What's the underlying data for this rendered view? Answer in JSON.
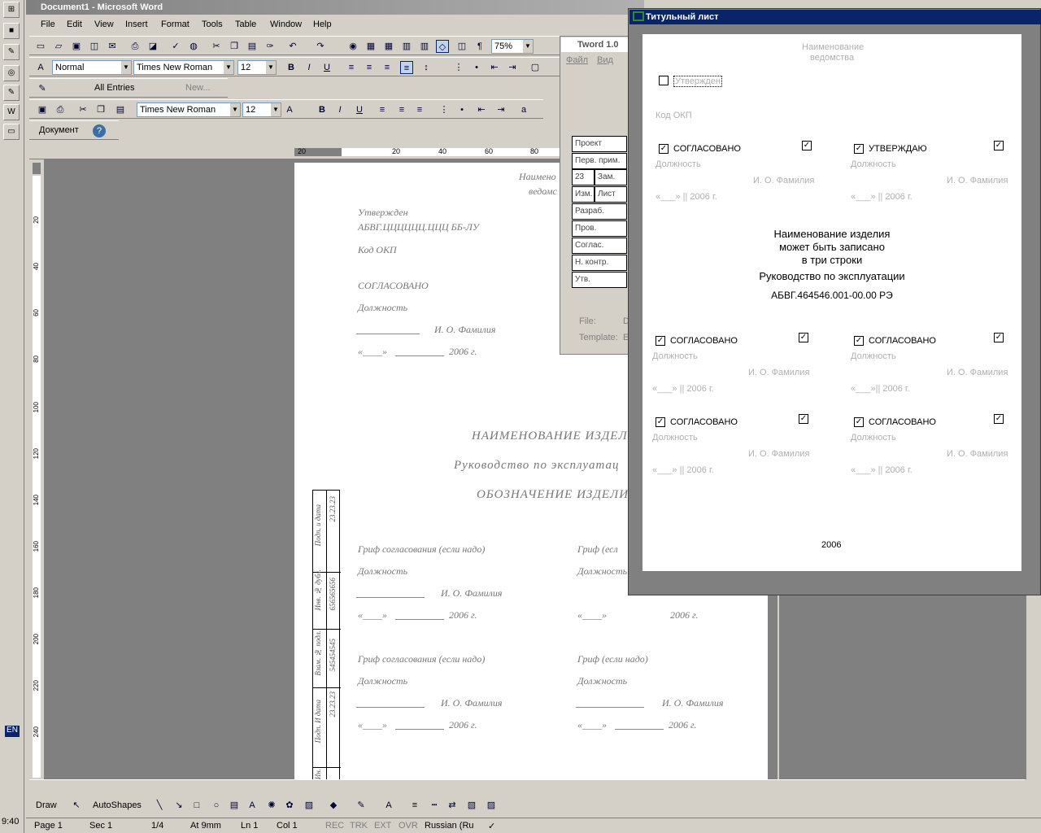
{
  "window": {
    "title": "Document1 - Microsoft Word"
  },
  "menu": [
    "File",
    "Edit",
    "View",
    "Insert",
    "Format",
    "Tools",
    "Table",
    "Window",
    "Help"
  ],
  "toolbar": {
    "zoom": "75%",
    "style": "Normal",
    "font": "Times New Roman",
    "size": "12",
    "font2": "Times New Roman",
    "size2": "12",
    "all_entries": "All Entries",
    "new": "New...",
    "document": "Документ"
  },
  "ruler": {
    "h": [
      "20",
      "20",
      "40",
      "60",
      "80"
    ],
    "v": [
      "20",
      "40",
      "60",
      "80",
      "100",
      "120",
      "140",
      "160",
      "180",
      "200",
      "220",
      "240"
    ]
  },
  "page": {
    "naim": "Наимено",
    "vedom": "ведомс",
    "utv": "Утвержден",
    "code": "АБВГ.ЦЦЦЦЦЦ.ЦЦЦ ББ-ЛУ",
    "okp": "Код ОКП",
    "sogl": "СОГЛАСОВАНО",
    "dolzh": "Должность",
    "fio": "И. О. Фамилия",
    "date1": "«____»",
    "year": "2006 г.",
    "title1": "НАИМЕНОВАНИЕ ИЗДЕЛИ",
    "title2": "Руководство по эксплуатац",
    "title3": "ОБОЗНАЧЕНИЕ ИЗДЕЛИЯ",
    "grif1": "Гриф согласования (если надо)",
    "grif2": "Гриф (есл",
    "grif3": "Гриф (если надо)",
    "side": [
      "Подп. и дата",
      "23.23.23",
      "Инв. № дубл.",
      "656565656",
      "Взам. № подл.",
      "545454545",
      "Подп. И дата",
      "23.23.23",
      "Ин."
    ]
  },
  "tword": {
    "title": "Tword 1.0",
    "menu": [
      "Файл",
      "Вид"
    ],
    "stamp": [
      "Проект",
      "Перв. прим.",
      "23",
      "Зам.",
      "Изм.",
      "Лист",
      "Разраб.",
      "Пров.",
      "Соглас.",
      "Н. контр.",
      "Утв."
    ],
    "file": "File:",
    "file_v": "D",
    "template": "Template:",
    "template_v": "E"
  },
  "dialog": {
    "title": "Титульный лист",
    "naim": "Наименование",
    "vedom": "ведомства",
    "utv": "Утвержден",
    "okp": "Код ОКП",
    "sogl": "СОГЛАСОВАНО",
    "utvd": "УТВЕРЖДАЮ",
    "dolzh": "Должность",
    "fio": "И. О. Фамилия",
    "date": "«___» || 2006 г.",
    "date2": "«___»|| 2006 г.",
    "name1": "Наименование изделия",
    "name2": "может быть записано",
    "name3": "в три строки",
    "doc": "Руководство по эксплуатации",
    "code": "АБВГ.464546.001-00.00 РЭ",
    "year": "2006"
  },
  "draw": {
    "draw": "Draw",
    "autoshapes": "AutoShapes"
  },
  "status": {
    "page": "Page 1",
    "sec": "Sec 1",
    "pages": "1/4",
    "at": "At 9mm",
    "ln": "Ln 1",
    "col": "Col 1",
    "rec": "REC",
    "trk": "TRK",
    "ext": "EXT",
    "ovr": "OVR",
    "lang": "Russian (Ru"
  },
  "tray": {
    "lang": "EN",
    "time": "9:40"
  }
}
